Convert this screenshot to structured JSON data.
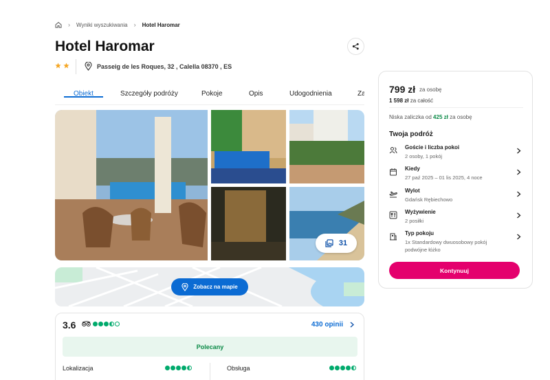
{
  "breadcrumb": {
    "items": [
      "Wyniki wyszukiwania",
      "Hotel Haromar"
    ]
  },
  "hotel": {
    "name": "Hotel Haromar",
    "stars": 2,
    "address": "Passeig de les Roques, 32 , Calella 08370 , ES"
  },
  "tabs": [
    {
      "label": "Obiekt",
      "active": true
    },
    {
      "label": "Szczegóły podróży"
    },
    {
      "label": "Pokoje"
    },
    {
      "label": "Opis"
    },
    {
      "label": "Udogodnienia"
    },
    {
      "label": "Za"
    }
  ],
  "gallery": {
    "count": "31"
  },
  "map": {
    "button_label": "Zobacz na mapie"
  },
  "review": {
    "score": "3.6",
    "tripadvisor_rating": 3.5,
    "opinions": "430 opinii",
    "badge": "Polecany",
    "items": [
      {
        "label": "Lokalizacja",
        "rating": 4.5
      },
      {
        "label": "Obsługa",
        "rating": 4.5
      }
    ]
  },
  "booking": {
    "price": "799 zł",
    "price_per": "za osobę",
    "total_amount": "1 598 zł",
    "total_suffix": "za całość",
    "deposit_prefix": "Niska zaliczka od",
    "deposit_amount": "425 zł",
    "deposit_suffix": "za osobę",
    "trip_title": "Twoja podróż",
    "rows": [
      {
        "icon": "guests-icon",
        "title": "Goście i liczba pokoi",
        "sub": "2 osoby, 1 pokój"
      },
      {
        "icon": "calendar-icon",
        "title": "Kiedy",
        "sub": "27 paź 2025 – 01 lis 2025, 4 noce"
      },
      {
        "icon": "plane-icon",
        "title": "Wylot",
        "sub": "Gdańsk Rębiechowo"
      },
      {
        "icon": "meals-icon",
        "title": "Wyżywienie",
        "sub": "2 posiłki"
      },
      {
        "icon": "room-icon",
        "title": "Typ pokoju",
        "sub": "1x Standardowy dwuosobowy pokój podwójne łóżko"
      }
    ],
    "continue_label": "Kontynuuj"
  },
  "colors": {
    "accent": "#0b6bd3",
    "cta": "#e4006d",
    "tripadvisor": "#00aa6c",
    "star": "#f5a623"
  }
}
